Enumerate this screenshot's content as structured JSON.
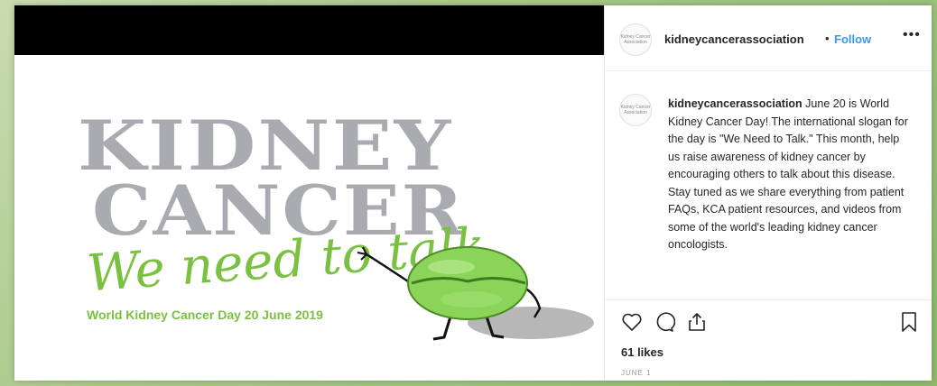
{
  "post": {
    "headline_line1": "KIDNEY",
    "headline_line2": "CANCER",
    "slogan": "We need to talk",
    "subline": "World Kidney Cancer Day 20 June 2019"
  },
  "header": {
    "username": "kidneycancerassociation",
    "separator": "•",
    "follow_label": "Follow",
    "more_label": "•••",
    "avatar_text": "Kidney Cancer Association"
  },
  "caption": {
    "username": "kidneycancerassociation",
    "text": " June 20 is World Kidney Cancer Day! The international slogan for the day is \"We Need to Talk.\" This month, help us raise awareness of kidney cancer by encouraging others to talk about this disease. Stay tuned as we share everything from patient FAQs, KCA patient resources, and videos from some of the world's leading kidney cancer oncologists."
  },
  "actions": {
    "likes": "61 likes",
    "date": "JUNE 1"
  },
  "colors": {
    "brand_green": "#7ac142",
    "headline_gray": "#a9abb0",
    "follow_blue": "#3897f0"
  }
}
